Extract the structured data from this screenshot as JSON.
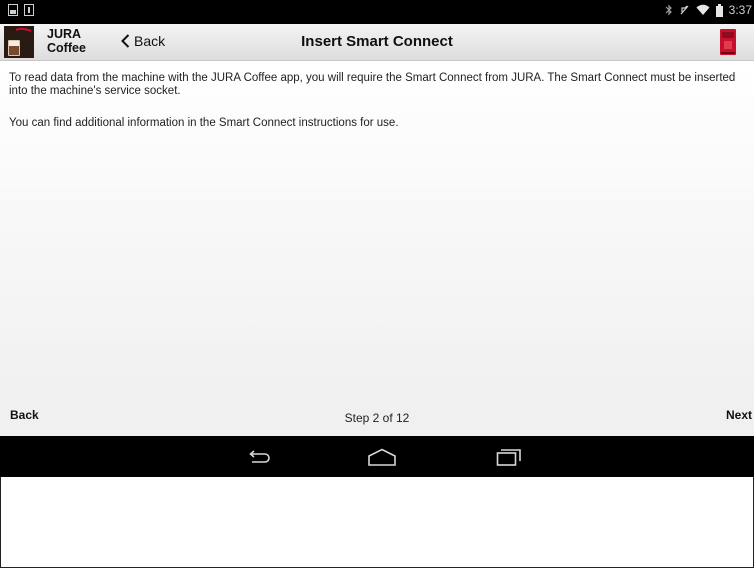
{
  "status_bar": {
    "time": "3:37",
    "icons": [
      "image-icon",
      "download-icon",
      "bluetooth-icon",
      "mute-icon",
      "wifi-icon",
      "battery-icon"
    ]
  },
  "action_bar": {
    "app_title_line1": "JURA",
    "app_title_line2": "Coffee",
    "back_label": "Back",
    "title": "Insert Smart Connect"
  },
  "content": {
    "paragraph1": "To read data from the machine with the JURA Coffee app, you will require the Smart Connect from JURA. The Smart Connect must be inserted into the machine's service socket.",
    "paragraph2": "You can find additional information in the Smart Connect instructions for use."
  },
  "footer": {
    "back_label": "Back",
    "step_text": "Step 2 of 12",
    "next_label": "Next"
  },
  "nav_bar": {
    "buttons": [
      "back-icon",
      "home-icon",
      "recents-icon"
    ]
  },
  "colors": {
    "brand_red": "#c8102e",
    "status_bar_bg": "#000000"
  }
}
